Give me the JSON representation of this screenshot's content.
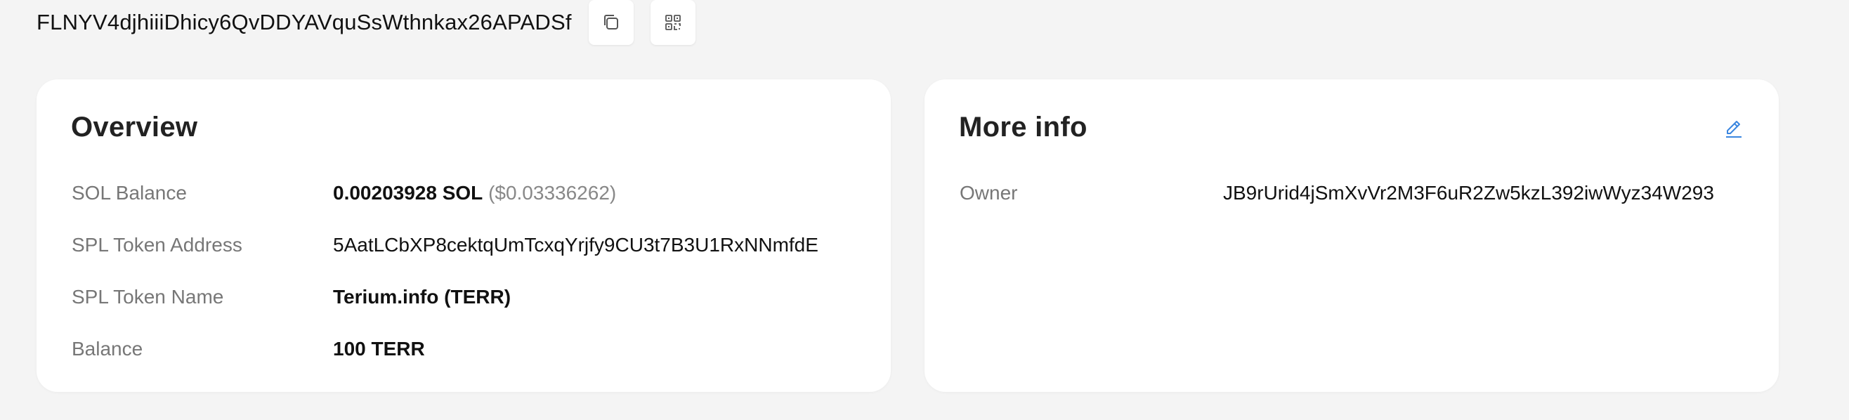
{
  "header": {
    "address": "FLNYV4djhiiiDhicy6QvDDYAVquSsWthnkax26APADSf",
    "copy_icon": "copy-icon",
    "qr_icon": "qr-code-icon"
  },
  "overview": {
    "title": "Overview",
    "rows": [
      {
        "label": "SOL Balance",
        "value": "0.00203928 SOL",
        "secondary": "($0.03336262)"
      },
      {
        "label": "SPL Token Address",
        "value": "5AatLCbXP8cektqUmTcxqYrjfy9CU3t7B3U1RxNNmfdE"
      },
      {
        "label": "SPL Token Name",
        "value": "Terium.info (TERR)"
      },
      {
        "label": "Balance",
        "value": "100 TERR"
      }
    ]
  },
  "more_info": {
    "title": "More info",
    "edit_icon": "pencil-icon",
    "rows": [
      {
        "label": "Owner",
        "value": "JB9rUrid4jSmXvVr2M3F6uR2Zw5kzL392iwWyz34W293"
      }
    ]
  },
  "colors": {
    "link": "#3a86e0",
    "background": "#f4f4f4",
    "card": "#ffffff",
    "label": "#777777"
  }
}
